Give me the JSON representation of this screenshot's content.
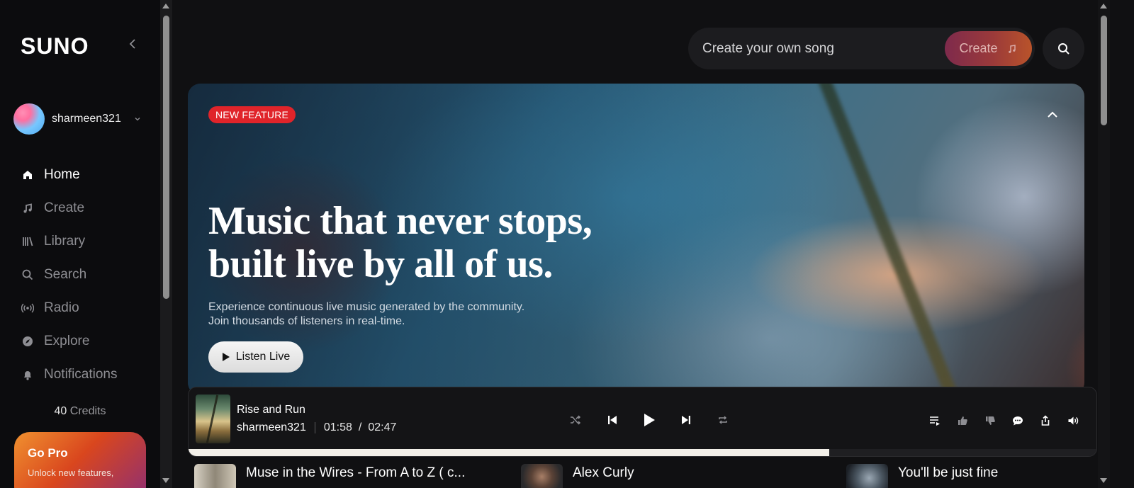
{
  "brand": {
    "logo": "SUNO"
  },
  "user": {
    "name": "sharmeen321"
  },
  "nav": [
    {
      "label": "Home",
      "icon": "home-icon",
      "active": true
    },
    {
      "label": "Create",
      "icon": "music-note-icon",
      "active": false
    },
    {
      "label": "Library",
      "icon": "library-icon",
      "active": false
    },
    {
      "label": "Search",
      "icon": "search-icon",
      "active": false
    },
    {
      "label": "Radio",
      "icon": "radio-icon",
      "active": false
    },
    {
      "label": "Explore",
      "icon": "compass-icon",
      "active": false
    },
    {
      "label": "Notifications",
      "icon": "bell-icon",
      "active": false
    }
  ],
  "credits": {
    "count": "40",
    "label": "Credits"
  },
  "gopro": {
    "title": "Go Pro",
    "subtitle": "Unlock new features,"
  },
  "topbar": {
    "create_placeholder": "Create your own song",
    "create_button": "Create"
  },
  "hero": {
    "badge": "NEW FEATURE",
    "title_line1": "Music that never stops,",
    "title_line2": "built live by all of us.",
    "sub_line1": "Experience continuous live music generated by the community.",
    "sub_line2": "Join thousands of listeners in real-time.",
    "button": "Listen Live"
  },
  "player": {
    "title": "Rise and Run",
    "artist": "sharmeen321",
    "current_time": "01:58",
    "separator": "/",
    "duration": "02:47",
    "progress_fraction": 0.706
  },
  "feed": [
    {
      "title": "Muse in the Wires - From A to Z ( c..."
    },
    {
      "title": "Alex Curly"
    },
    {
      "title": "You'll be just fine"
    }
  ],
  "colors": {
    "accent": "#e0242a",
    "background": "#101012",
    "sidebar": "#0c0c0e"
  }
}
